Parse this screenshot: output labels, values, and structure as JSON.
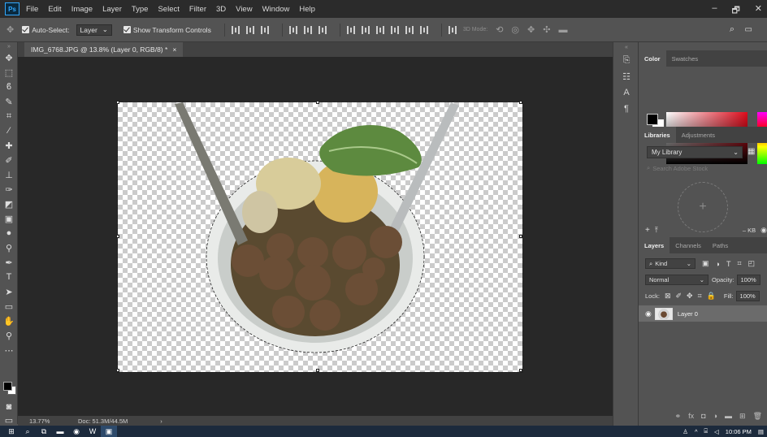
{
  "app": {
    "logo": "Ps"
  },
  "menu": [
    "File",
    "Edit",
    "Image",
    "Layer",
    "Type",
    "Select",
    "Filter",
    "3D",
    "View",
    "Window",
    "Help"
  ],
  "window_controls": [
    "–",
    "🗗",
    "✕"
  ],
  "options": {
    "auto_select_label": "Auto-Select:",
    "auto_select_value": "Layer",
    "transform_label": "Show Transform Controls",
    "mode_3d_label": "3D Mode:"
  },
  "document": {
    "tab_title": "IMG_6768.JPG @ 13.8% (Layer 0, RGB/8) *",
    "tab_close": "×"
  },
  "status": {
    "zoom": "13.77%",
    "doc_size": "Doc: 51.3M/44.5M"
  },
  "color_panel": {
    "tabs": [
      "Color",
      "Swatches"
    ]
  },
  "libraries_panel": {
    "tabs": [
      "Libraries",
      "Adjustments"
    ],
    "library_name": "My Library",
    "search_placeholder": "Search Adobe Stock",
    "size_text": "– KB"
  },
  "layers_panel": {
    "tabs": [
      "Layers",
      "Channels",
      "Paths"
    ],
    "filter_kind": "Kind",
    "blend_mode": "Normal",
    "opacity_label": "Opacity:",
    "opacity_value": "100%",
    "lock_label": "Lock:",
    "fill_label": "Fill:",
    "fill_value": "100%",
    "layers": [
      {
        "name": "Layer 0",
        "visible": true
      }
    ]
  },
  "taskbar": {
    "time": "10:06 PM"
  }
}
